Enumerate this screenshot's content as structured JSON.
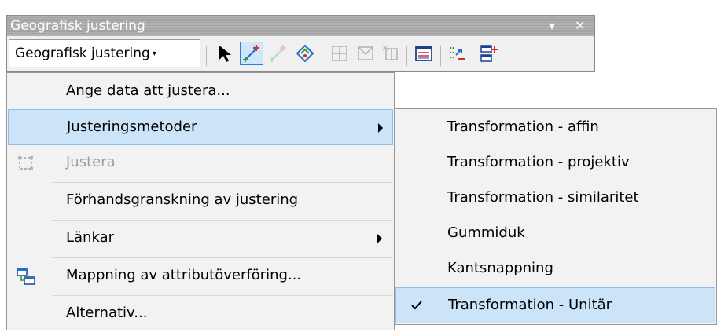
{
  "window": {
    "title": "Geografisk justering",
    "menu_arrow_glyph": "▾",
    "close_glyph": "✕"
  },
  "toolbar": {
    "dropdown_label": "Geografisk justering",
    "dropdown_arrow": "▾"
  },
  "menu": {
    "items": [
      {
        "label": "Ange data att justera..."
      },
      {
        "label": "Justeringsmetoder"
      },
      {
        "label": "Justera"
      },
      {
        "label": "Förhandsgranskning av justering"
      },
      {
        "label": "Länkar"
      },
      {
        "label": "Mappning av attributöverföring..."
      },
      {
        "label": "Alternativ..."
      }
    ]
  },
  "submenu": {
    "items": [
      {
        "label": "Transformation - affin"
      },
      {
        "label": "Transformation - projektiv"
      },
      {
        "label": "Transformation - similaritet"
      },
      {
        "label": "Gummiduk"
      },
      {
        "label": "Kantsnappning"
      },
      {
        "label": "Transformation - Unitär"
      }
    ]
  },
  "colors": {
    "highlight": "#cce4f7",
    "highlight_border": "#8fbde8",
    "menu_bg": "#f2f2f2",
    "titlebar": "#a8a8a8",
    "accent_green": "#2aa02a",
    "accent_red": "#e0262a",
    "accent_blue": "#1f6fcf"
  }
}
